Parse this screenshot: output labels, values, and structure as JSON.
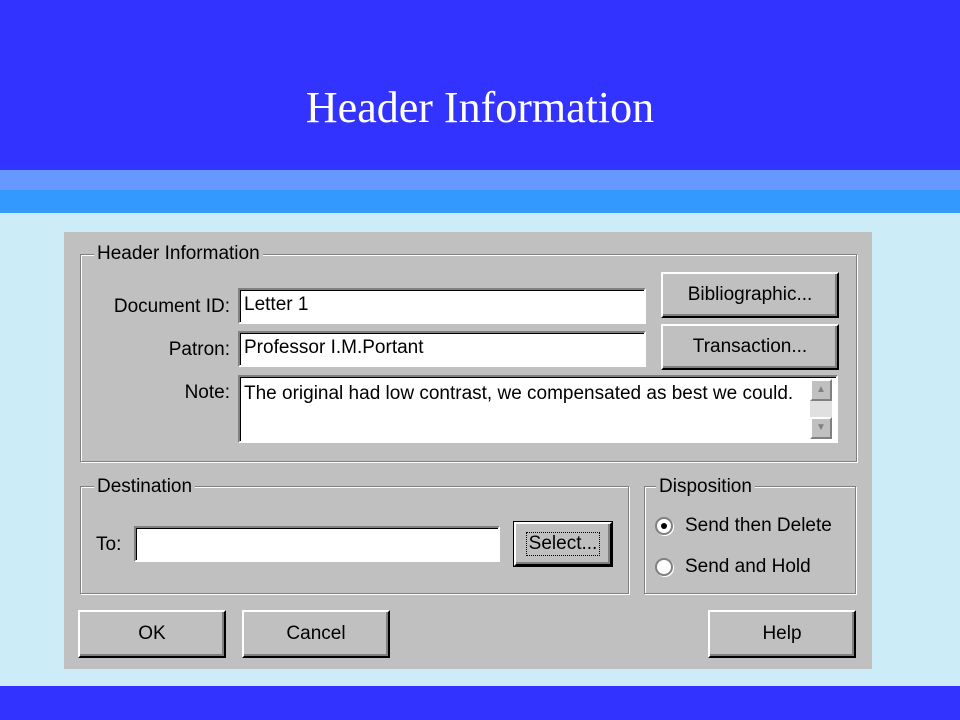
{
  "slide": {
    "title": "Header Information"
  },
  "dialog": {
    "header_group": {
      "legend": "Header Information",
      "document_id_label": "Document ID:",
      "document_id_value": "Letter 1",
      "patron_label": "Patron:",
      "patron_value": "Professor I.M.Portant",
      "note_label": "Note:",
      "note_value": "The original had low contrast, we compensated as best we could.",
      "bibliographic_button": "Bibliographic...",
      "transaction_button": "Transaction..."
    },
    "destination_group": {
      "legend": "Destination",
      "to_label": "To:",
      "to_value": "",
      "select_button": "Select..."
    },
    "disposition_group": {
      "legend": "Disposition",
      "options": [
        {
          "label": "Send then Delete",
          "selected": true
        },
        {
          "label": "Send and Hold",
          "selected": false
        }
      ]
    },
    "buttons": {
      "ok": "OK",
      "cancel": "Cancel",
      "help": "Help"
    }
  },
  "colors": {
    "title_bar": "#3333ff",
    "slide_background": "#ccecf8",
    "dialog_face": "#c0c0c0"
  },
  "icons": {
    "scroll_up": "scroll-up-arrow-icon",
    "scroll_down": "scroll-down-arrow-icon"
  }
}
